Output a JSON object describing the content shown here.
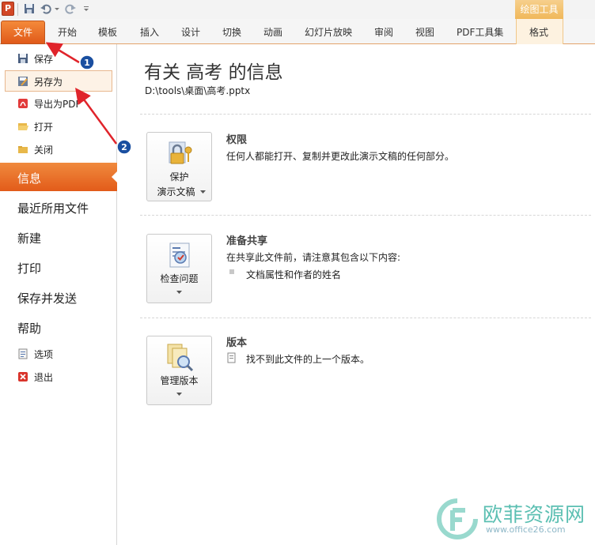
{
  "quick_access": {
    "app_icon": "P"
  },
  "context_group": {
    "label": "绘图工具"
  },
  "tabs": {
    "file": "文件",
    "items": [
      "开始",
      "模板",
      "插入",
      "设计",
      "切换",
      "动画",
      "幻灯片放映",
      "审阅",
      "视图",
      "PDF工具集",
      "格式"
    ]
  },
  "nav": {
    "save": "保存",
    "save_as": "另存为",
    "export_pdf": "导出为PDF",
    "open": "打开",
    "close": "关闭",
    "info": "信息",
    "recent": "最近所用文件",
    "new": "新建",
    "print": "打印",
    "save_send": "保存并发送",
    "help": "帮助",
    "options": "选项",
    "exit": "退出"
  },
  "info": {
    "title": "有关 高考 的信息",
    "path": "D:\\tools\\桌面\\高考.pptx"
  },
  "sections": {
    "permissions": {
      "button_line1": "保护",
      "button_line2": "演示文稿",
      "heading": "权限",
      "text": "任何人都能打开、复制并更改此演示文稿的任何部分。"
    },
    "prepare": {
      "button_line1": "检查问题",
      "heading": "准备共享",
      "text": "在共享此文件前，请注意其包含以下内容:",
      "bullet": "文档属性和作者的姓名"
    },
    "versions": {
      "button_line1": "管理版本",
      "heading": "版本",
      "text": "找不到此文件的上一个版本。"
    }
  },
  "annotations": {
    "step1": "1",
    "step2": "2"
  },
  "watermark": {
    "text": "欧菲资源网",
    "url": "www.office26.com"
  },
  "colors": {
    "accent_orange": "#e25b1a",
    "annotation_red": "#e0242b",
    "annotation_blue": "#1a4fa0"
  }
}
